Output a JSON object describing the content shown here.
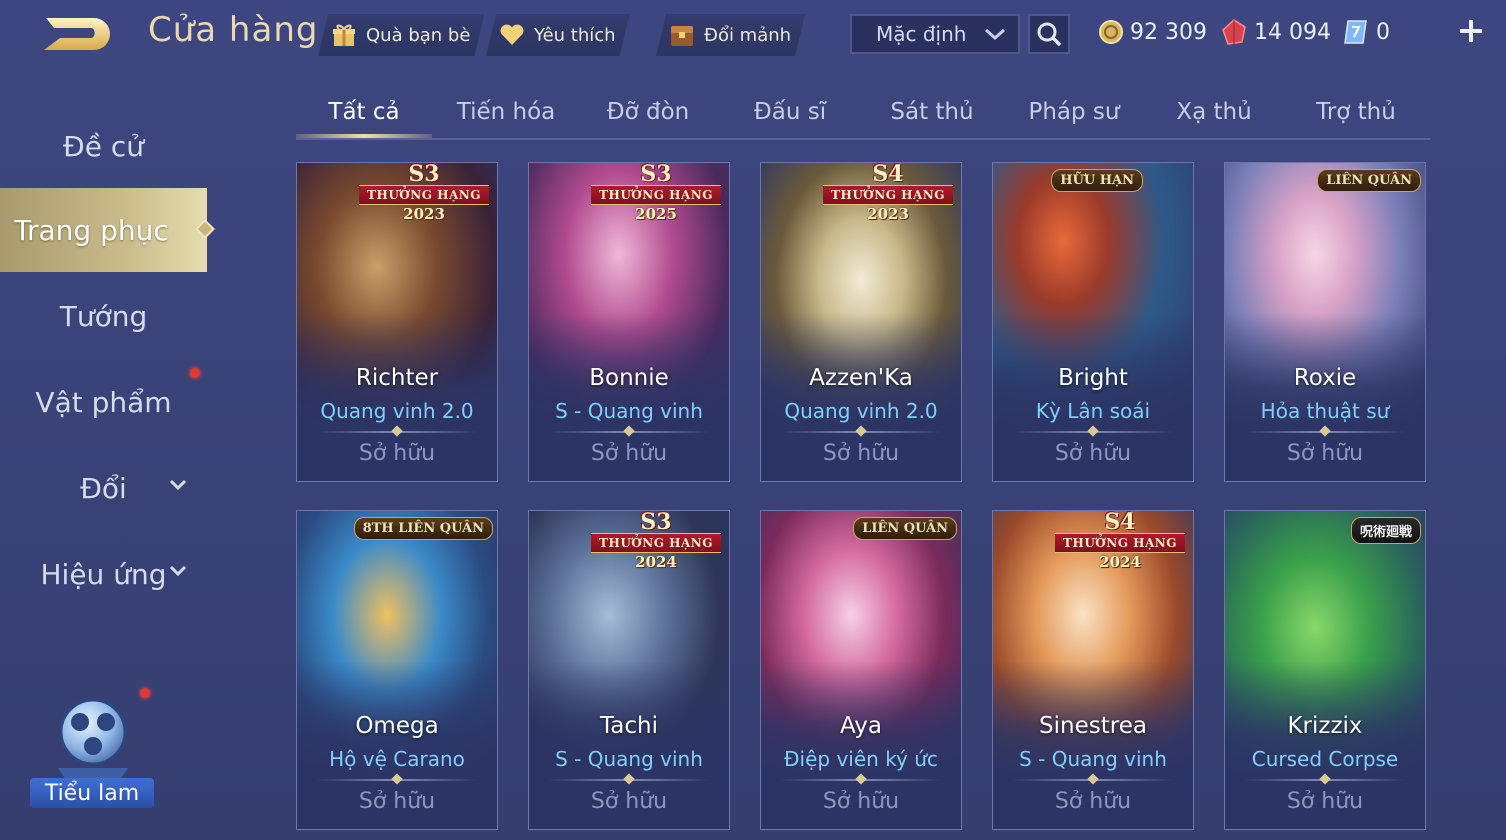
{
  "header": {
    "title": "Cửa hàng",
    "friend_gift": "Quà bạn bè",
    "favorites": "Yêu thích",
    "exchange_fragments": "Đổi mảnh",
    "sort_value": "Mặc định",
    "gold": "92 309",
    "vouchers": "14 094",
    "diamonds": "0"
  },
  "sidebar": {
    "items": [
      {
        "label": "Đề cử"
      },
      {
        "label": "Trang phục"
      },
      {
        "label": "Tướng"
      },
      {
        "label": "Vật phẩm"
      },
      {
        "label": "Đổi"
      },
      {
        "label": "Hiệu ứng"
      }
    ],
    "mascot_label": "Tiểu lam"
  },
  "tabs": [
    "Tất cả",
    "Tiến hóa",
    "Đỡ đòn",
    "Đấu sĩ",
    "Sát thủ",
    "Pháp sư",
    "Xạ thủ",
    "Trợ thủ"
  ],
  "cards": [
    {
      "hero": "Richter",
      "skin": "Quang vinh 2.0",
      "status": "Sở hữu",
      "badge_season": "S3",
      "badge_text": "THƯỞNG HẠNG",
      "badge_year": "2023"
    },
    {
      "hero": "Bonnie",
      "skin": "S - Quang vinh",
      "status": "Sở hữu",
      "badge_season": "S3",
      "badge_text": "THƯỞNG HẠNG",
      "badge_year": "2025"
    },
    {
      "hero": "Azzen'Ka",
      "skin": "Quang vinh 2.0",
      "status": "Sở hữu",
      "badge_season": "S4",
      "badge_text": "THƯỞNG HẠNG",
      "badge_year": "2023"
    },
    {
      "hero": "Bright",
      "skin": "Kỳ Lân soái",
      "status": "Sở hữu",
      "badge_logo": "HỮU HẠN"
    },
    {
      "hero": "Roxie",
      "skin": "Hỏa thuật sư",
      "status": "Sở hữu",
      "badge_logo": "LIÊN QUÂN"
    },
    {
      "hero": "Omega",
      "skin": "Hộ vệ Carano",
      "status": "Sở hữu",
      "badge_logo": "8TH LIÊN QUÂN"
    },
    {
      "hero": "Tachi",
      "skin": "S - Quang vinh",
      "status": "Sở hữu",
      "badge_season": "S3",
      "badge_text": "THƯỞNG HẠNG",
      "badge_year": "2024"
    },
    {
      "hero": "Aya",
      "skin": "Điệp viên ký ức",
      "status": "Sở hữu",
      "badge_logo": "LIÊN QUÂN"
    },
    {
      "hero": "Sinestrea",
      "skin": "S - Quang vinh",
      "status": "Sở hữu",
      "badge_season": "S4",
      "badge_text": "THƯỞNG HẠNG",
      "badge_year": "2024"
    },
    {
      "hero": "Krizzix",
      "skin": "Cursed Corpse",
      "status": "Sở hữu",
      "badge_logo": "呪術廻戦"
    }
  ],
  "colors": {
    "background": "#3a4379",
    "accent_gold": "#e8d9b0",
    "skin_name": "#7fd0ff",
    "owned_status": "#8f96bd",
    "notify_dot": "#e03a2e"
  },
  "icons": [
    "back-arrow-icon",
    "gift-icon",
    "heart-icon",
    "fragment-chest-icon",
    "chevron-down-icon",
    "search-icon",
    "gold-coin-icon",
    "red-voucher-icon",
    "diamond-icon",
    "plus-icon"
  ]
}
